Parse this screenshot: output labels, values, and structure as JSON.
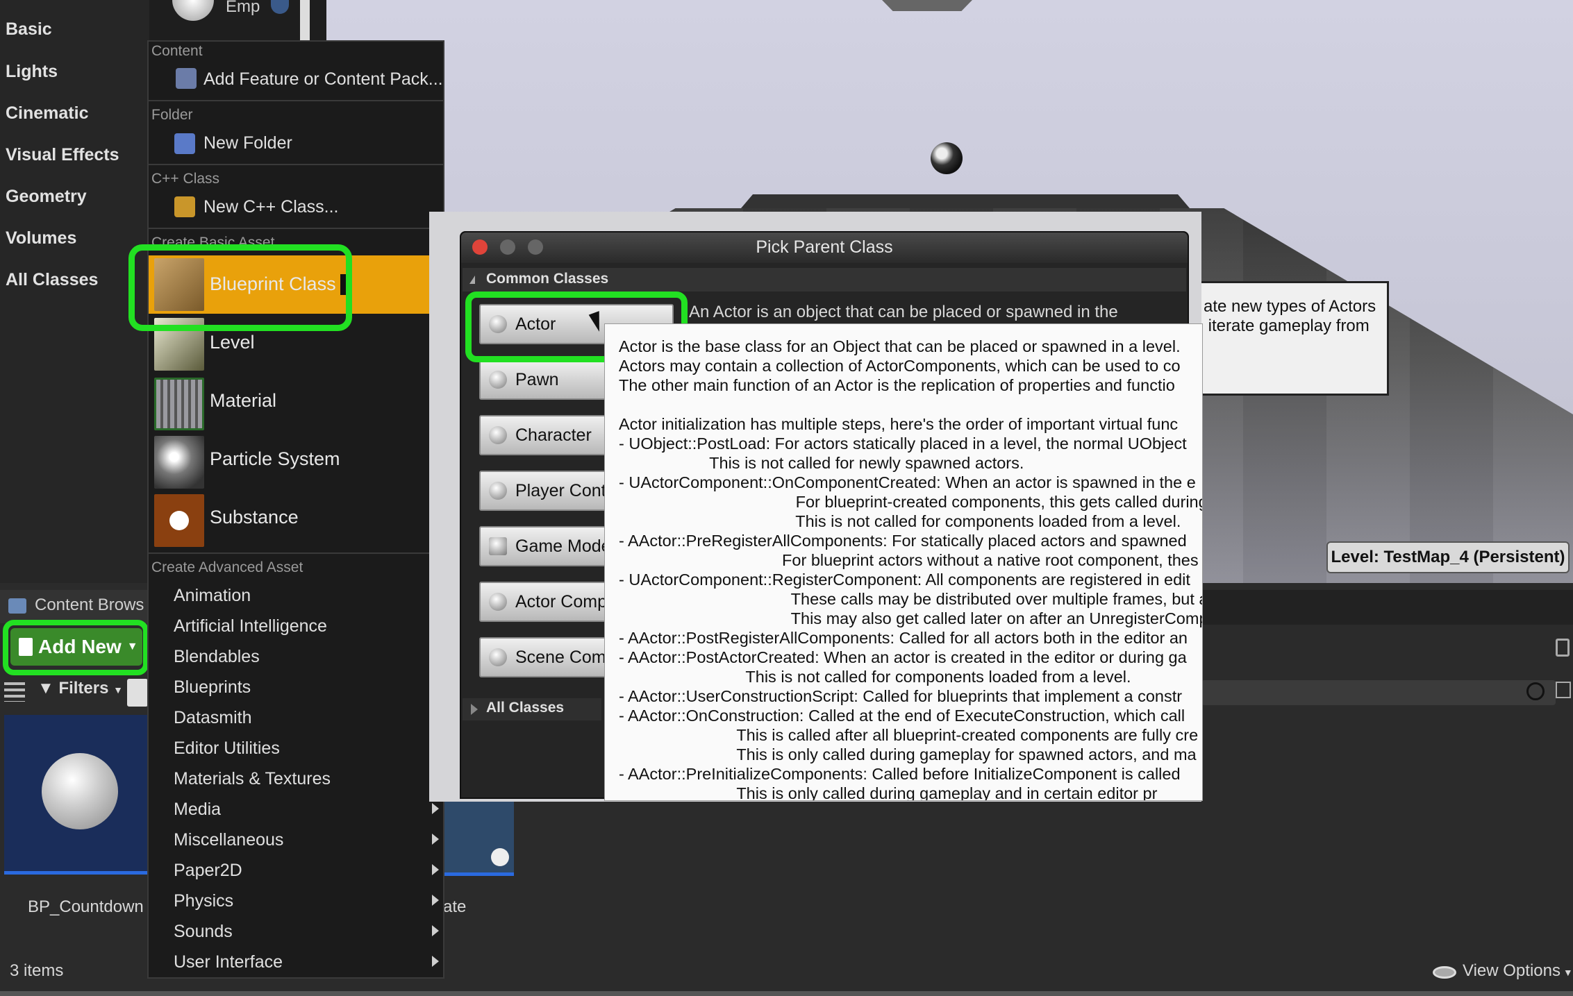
{
  "categories": [
    "Basic",
    "Lights",
    "Cinematic",
    "Visual Effects",
    "Geometry",
    "Volumes",
    "All Classes"
  ],
  "place_item": {
    "label": "Emp"
  },
  "viewport": {
    "level_label": "Level:  TestMap_4 (Persistent)",
    "side_tooltip": "ate new types of Actors\n iterate gameplay from"
  },
  "menu": {
    "content_header": "Content",
    "add_feature": "Add Feature or Content Pack...",
    "folder_header": "Folder",
    "new_folder": "New Folder",
    "cpp_header": "C++ Class",
    "new_cpp": "New C++ Class...",
    "basic_header": "Create Basic Asset",
    "basic_items": [
      "Blueprint Class",
      "Level",
      "Material",
      "Particle System",
      "Substance"
    ],
    "advanced_header": "Create Advanced Asset",
    "advanced_items": [
      "Animation",
      "Artificial Intelligence",
      "Blendables",
      "Blueprints",
      "Datasmith",
      "Editor Utilities",
      "Materials & Textures",
      "Media",
      "Miscellaneous",
      "Paper2D",
      "Physics",
      "Sounds",
      "User Interface"
    ]
  },
  "dialog": {
    "title": "Pick Parent Class",
    "common_classes": "Common Classes",
    "classes": [
      "Actor",
      "Pawn",
      "Character",
      "Player Cont",
      "Game Mode",
      "Actor Comp",
      "Scene Comp"
    ],
    "actor_description": "An Actor is an object that can be placed or spawned in the",
    "all_classes": "All Classes"
  },
  "tooltip": {
    "text": "Actor is the base class for an Object that can be placed or spawned in a level.\nActors may contain a collection of ActorComponents, which can be used to co\nThe other main function of an Actor is the replication of properties and functio\n\nActor initialization has multiple steps, here's the order of important virtual func\n- UObject::PostLoad: For actors statically placed in a level, the normal UObject\n                    This is not called for newly spawned actors.\n- UActorComponent::OnComponentCreated: When an actor is spawned in the e\n                                       For blueprint-created components, this gets called during\n                                       This is not called for components loaded from a level.\n- AActor::PreRegisterAllComponents: For statically placed actors and spawned\n                                    For blueprint actors without a native root component, thes\n- UActorComponent::RegisterComponent: All components are registered in edit\n                                      These calls may be distributed over multiple frames, but a\n                                      This may also get called later on after an UnregisterComp\n- AActor::PostRegisterAllComponents: Called for all actors both in the editor an\n- AActor::PostActorCreated: When an actor is created in the editor or during ga\n                            This is not called for components loaded from a level.\n- AActor::UserConstructionScript: Called for blueprints that implement a constr\n- AActor::OnConstruction: Called at the end of ExecuteConstruction, which call\n                          This is called after all blueprint-created components are fully cre\n                          This is only called during gameplay for spawned actors, and ma\n- AActor::PreInitializeComponents: Called before InitializeComponent is called\n                          This is only called during gameplay and in certain editor pr"
  },
  "content_browser": {
    "title": "Content Brows",
    "add_new": "Add New",
    "filters": "Filters",
    "asset1": "BP_Countdown",
    "asset2": "ate",
    "items_count": "3 items",
    "view_options": "View Options"
  },
  "colors": {
    "highlight": "#e9a10b",
    "outline": "#22e022",
    "add_new": "#3a8a2a"
  }
}
